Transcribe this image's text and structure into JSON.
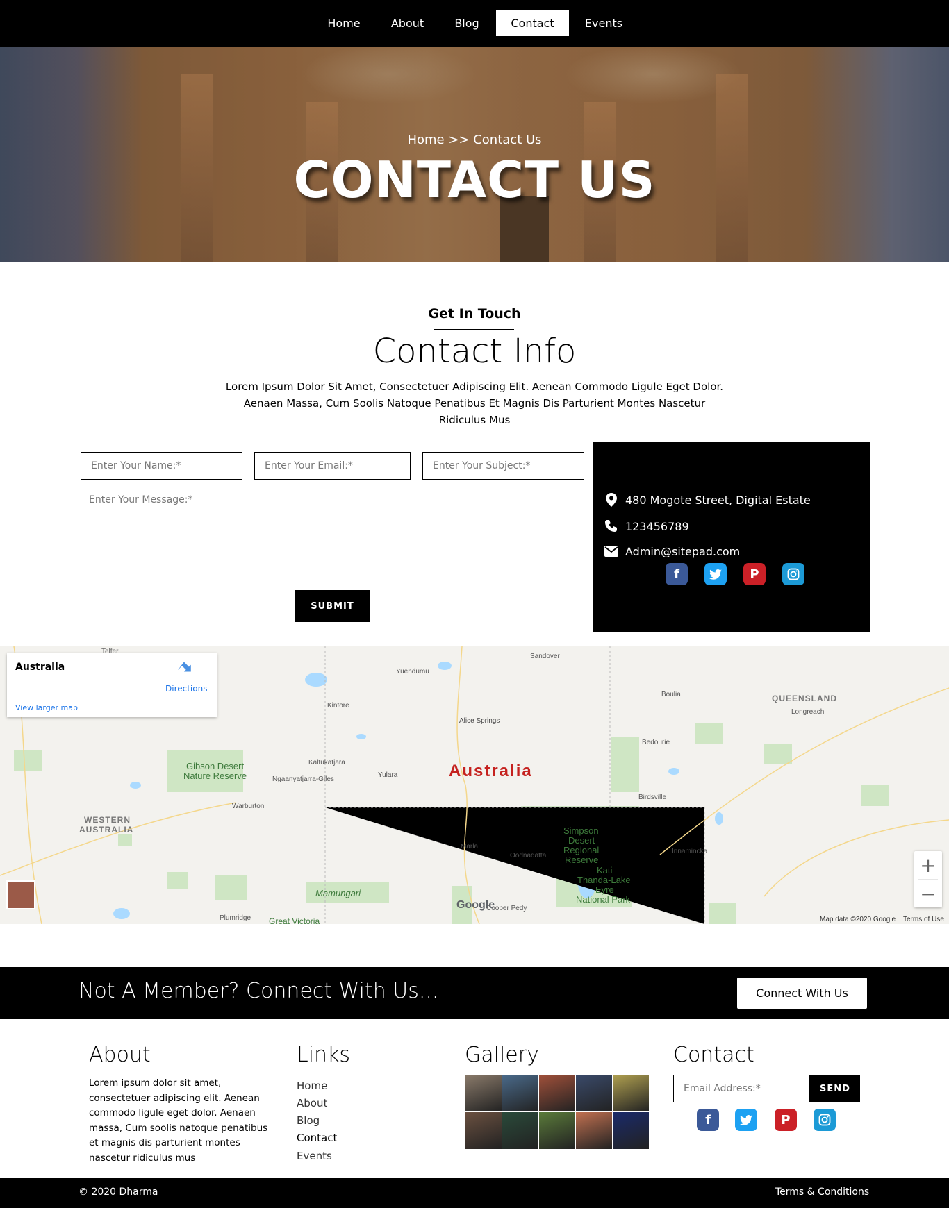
{
  "colors": {
    "black": "#000000",
    "white": "#ffffff",
    "facebook": "#3b5998",
    "twitter": "#1da1f2",
    "pinterest": "#cb2027",
    "instagram": "#1c9ad6",
    "map_link": "#1a73e8",
    "map_accent": "#c5221f"
  },
  "nav": {
    "items": [
      {
        "label": "Home"
      },
      {
        "label": "About"
      },
      {
        "label": "Blog"
      },
      {
        "label": "Contact",
        "active": true
      },
      {
        "label": "Events"
      }
    ]
  },
  "hero": {
    "breadcrumb": "Home >> Contact Us",
    "title": "CONTACT US"
  },
  "contact_section": {
    "eyebrow": "Get In Touch",
    "title": "Contact Info",
    "description": "Lorem Ipsum Dolor Sit Amet, Consectetuer Adipiscing Elit. Aenean Commodo Ligule Eget Dolor. Aenaen Massa, Cum Soolis Natoque Penatibus Et Magnis Dis Parturient Montes Nascetur Ridiculus Mus"
  },
  "form": {
    "name_placeholder": "Enter Your Name:*",
    "email_placeholder": "Enter Your Email:*",
    "subject_placeholder": "Enter Your Subject:*",
    "message_placeholder": "Enter Your Message:*",
    "submit_label": "SUBMIT"
  },
  "contact_card": {
    "address": "480 Mogote Street, Digital Estate",
    "phone": "123456789",
    "email": "Admin@sitepad.com",
    "address_icon": "map-marker-icon",
    "phone_icon": "phone-icon",
    "email_icon": "envelope-icon",
    "socials": [
      "facebook-icon",
      "twitter-icon",
      "pinterest-icon",
      "instagram-icon"
    ]
  },
  "map": {
    "place_name": "Australia",
    "directions_label": "Directions",
    "larger_map_label": "View larger map",
    "center_label": "Australia",
    "labels": {
      "telfer": "Telfer",
      "sandover": "Sandover",
      "yuendumu": "Yuendumu",
      "kintore": "Kintore",
      "alice_springs": "Alice Springs",
      "boulia": "Boulia",
      "queensland": "QUEENSLAND",
      "longreach": "Longreach",
      "bedourie": "Bedourie",
      "gibson_1": "Gibson Desert",
      "gibson_2": "Nature Reserve",
      "kaltukatjara": "Kaltukatjara",
      "ngaanyatjarra": "Ngaanyatjarra-Giles",
      "yulara": "Yulara",
      "birdsville": "Birdsville",
      "warburton": "Warburton",
      "wa_1": "WESTERN",
      "wa_2": "AUSTRALIA",
      "simpson_1": "Simpson",
      "simpson_2": "Desert",
      "simpson_3": "Regional",
      "simpson_4": "Reserve",
      "marla": "Marla",
      "oodnadatta": "Oodnadatta",
      "innamincka": "Innamincka",
      "kati_1": "Kati",
      "kati_2": "Thanda-Lake",
      "kati_3": "Eyre",
      "kati_4": "National Park",
      "mamungari": "Mamungari",
      "coober_pedy": "Coober Pedy",
      "plumridge": "Plumridge",
      "great_victoria": "Great Victoria"
    },
    "google_logo": "Google",
    "attribution": "Map data ©2020 Google",
    "terms": "Terms of Use",
    "zoom_in": "+",
    "zoom_out": "−"
  },
  "member_bar": {
    "text": "Not A Member? Connect With Us...",
    "button_label": "Connect With Us"
  },
  "footer": {
    "about_title": "About",
    "about_text": "Lorem ipsum dolor sit amet, consectetuer adipiscing elit. Aenean commodo ligule eget dolor. Aenaen massa, Cum soolis natoque penatibus et magnis dis parturient montes nascetur ridiculus mus",
    "links_title": "Links",
    "links": [
      {
        "label": "Home"
      },
      {
        "label": "About"
      },
      {
        "label": "Blog"
      },
      {
        "label": "Contact",
        "active": true
      },
      {
        "label": "Events"
      }
    ],
    "gallery_title": "Gallery",
    "gallery_colors": [
      "#8a7a6a",
      "#4a6a8a",
      "#a0503a",
      "#3a4a6a",
      "#b0a050",
      "#6a5040",
      "#2a4a3a",
      "#5a7a3a",
      "#c07050",
      "#1a2a6a"
    ],
    "contact_title": "Contact",
    "email_placeholder": "Email Address:*",
    "send_label": "SEND"
  },
  "bottom_bar": {
    "copyright": "© 2020 Dharma",
    "terms": "Terms & Conditions"
  }
}
